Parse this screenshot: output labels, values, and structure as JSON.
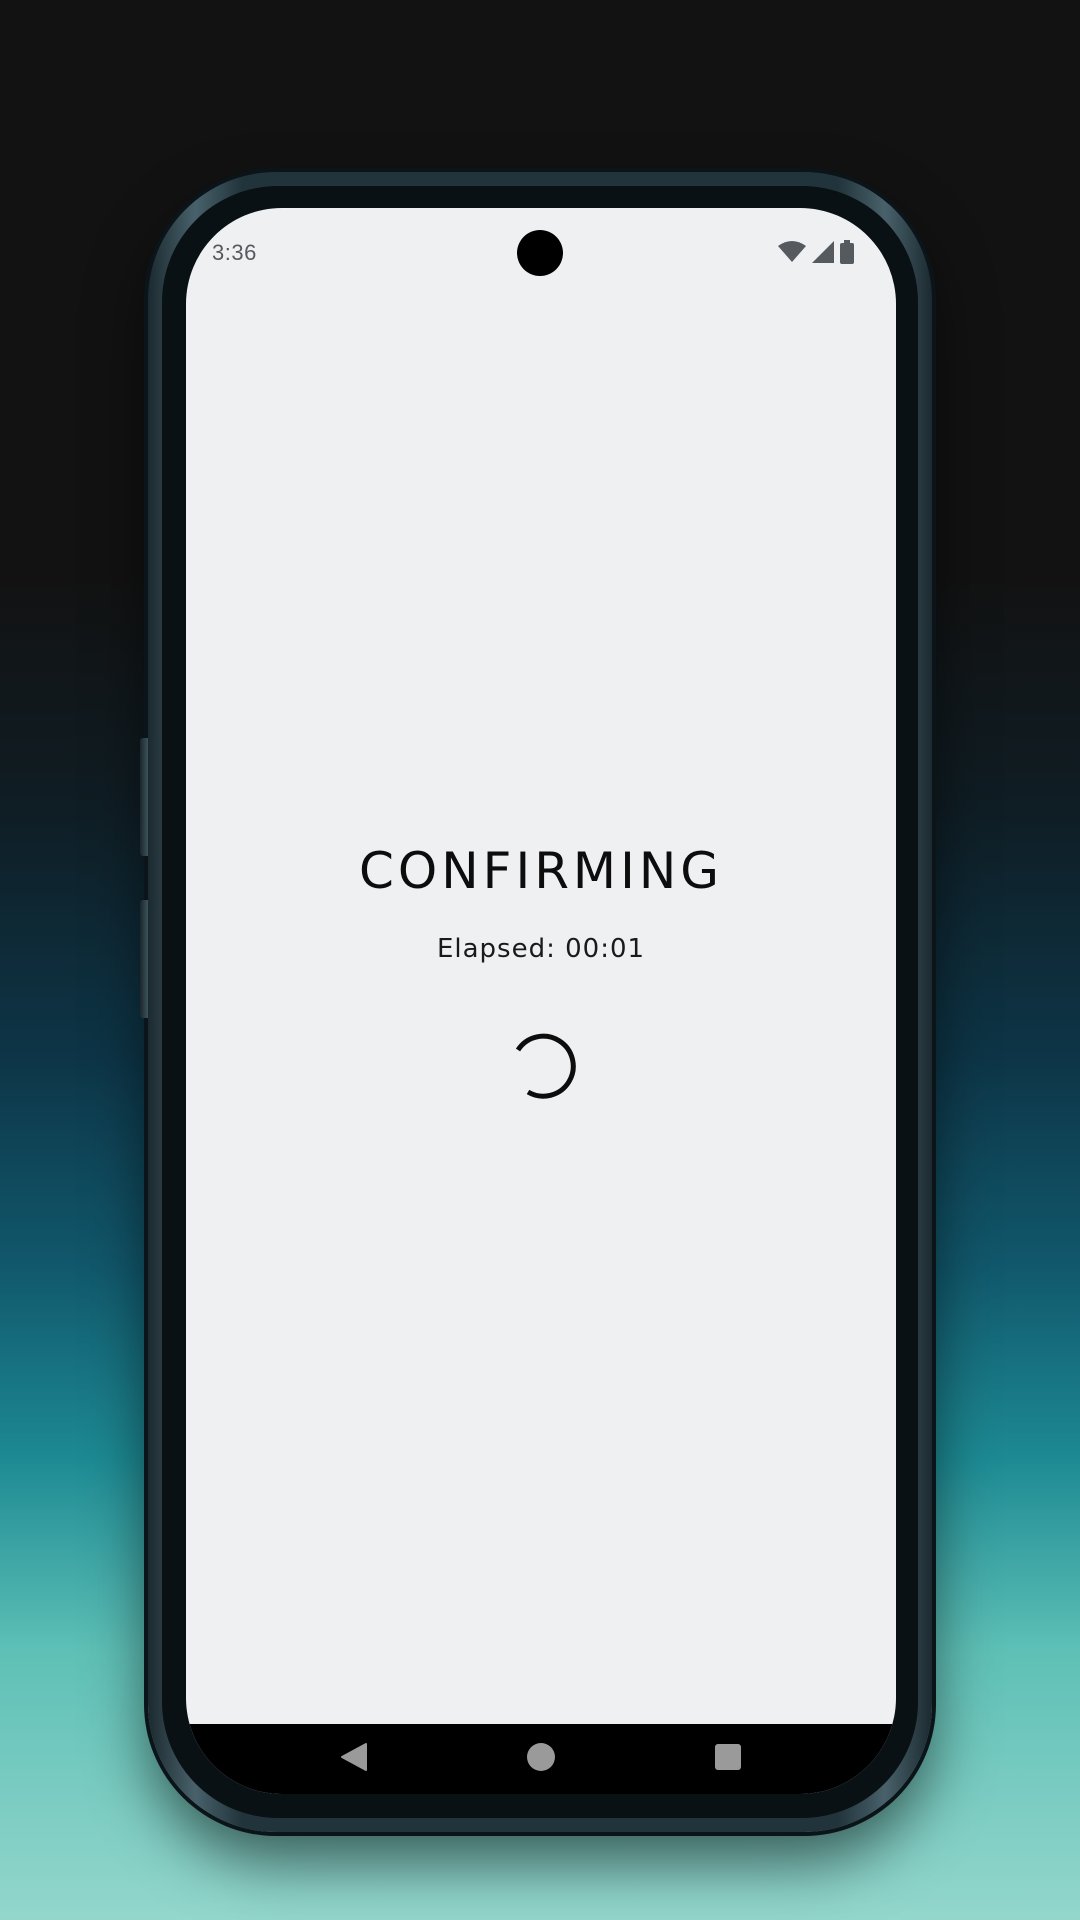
{
  "status_bar": {
    "time": "3:36",
    "icons": [
      "wifi-icon",
      "cellular-signal-icon",
      "battery-icon"
    ]
  },
  "main": {
    "title": "CONFIRMING",
    "elapsed_label": "Elapsed:",
    "elapsed_value": "00:01",
    "loading_indicator": "spinner-icon"
  },
  "nav_bar": {
    "buttons": [
      "back-icon",
      "home-icon",
      "recents-icon"
    ]
  },
  "colors": {
    "screen_background": "#eff0f2",
    "text": "#0d0d0d",
    "status_icon": "#555a5e",
    "nav_background": "#000000",
    "nav_icon": "#9a9a9a"
  }
}
